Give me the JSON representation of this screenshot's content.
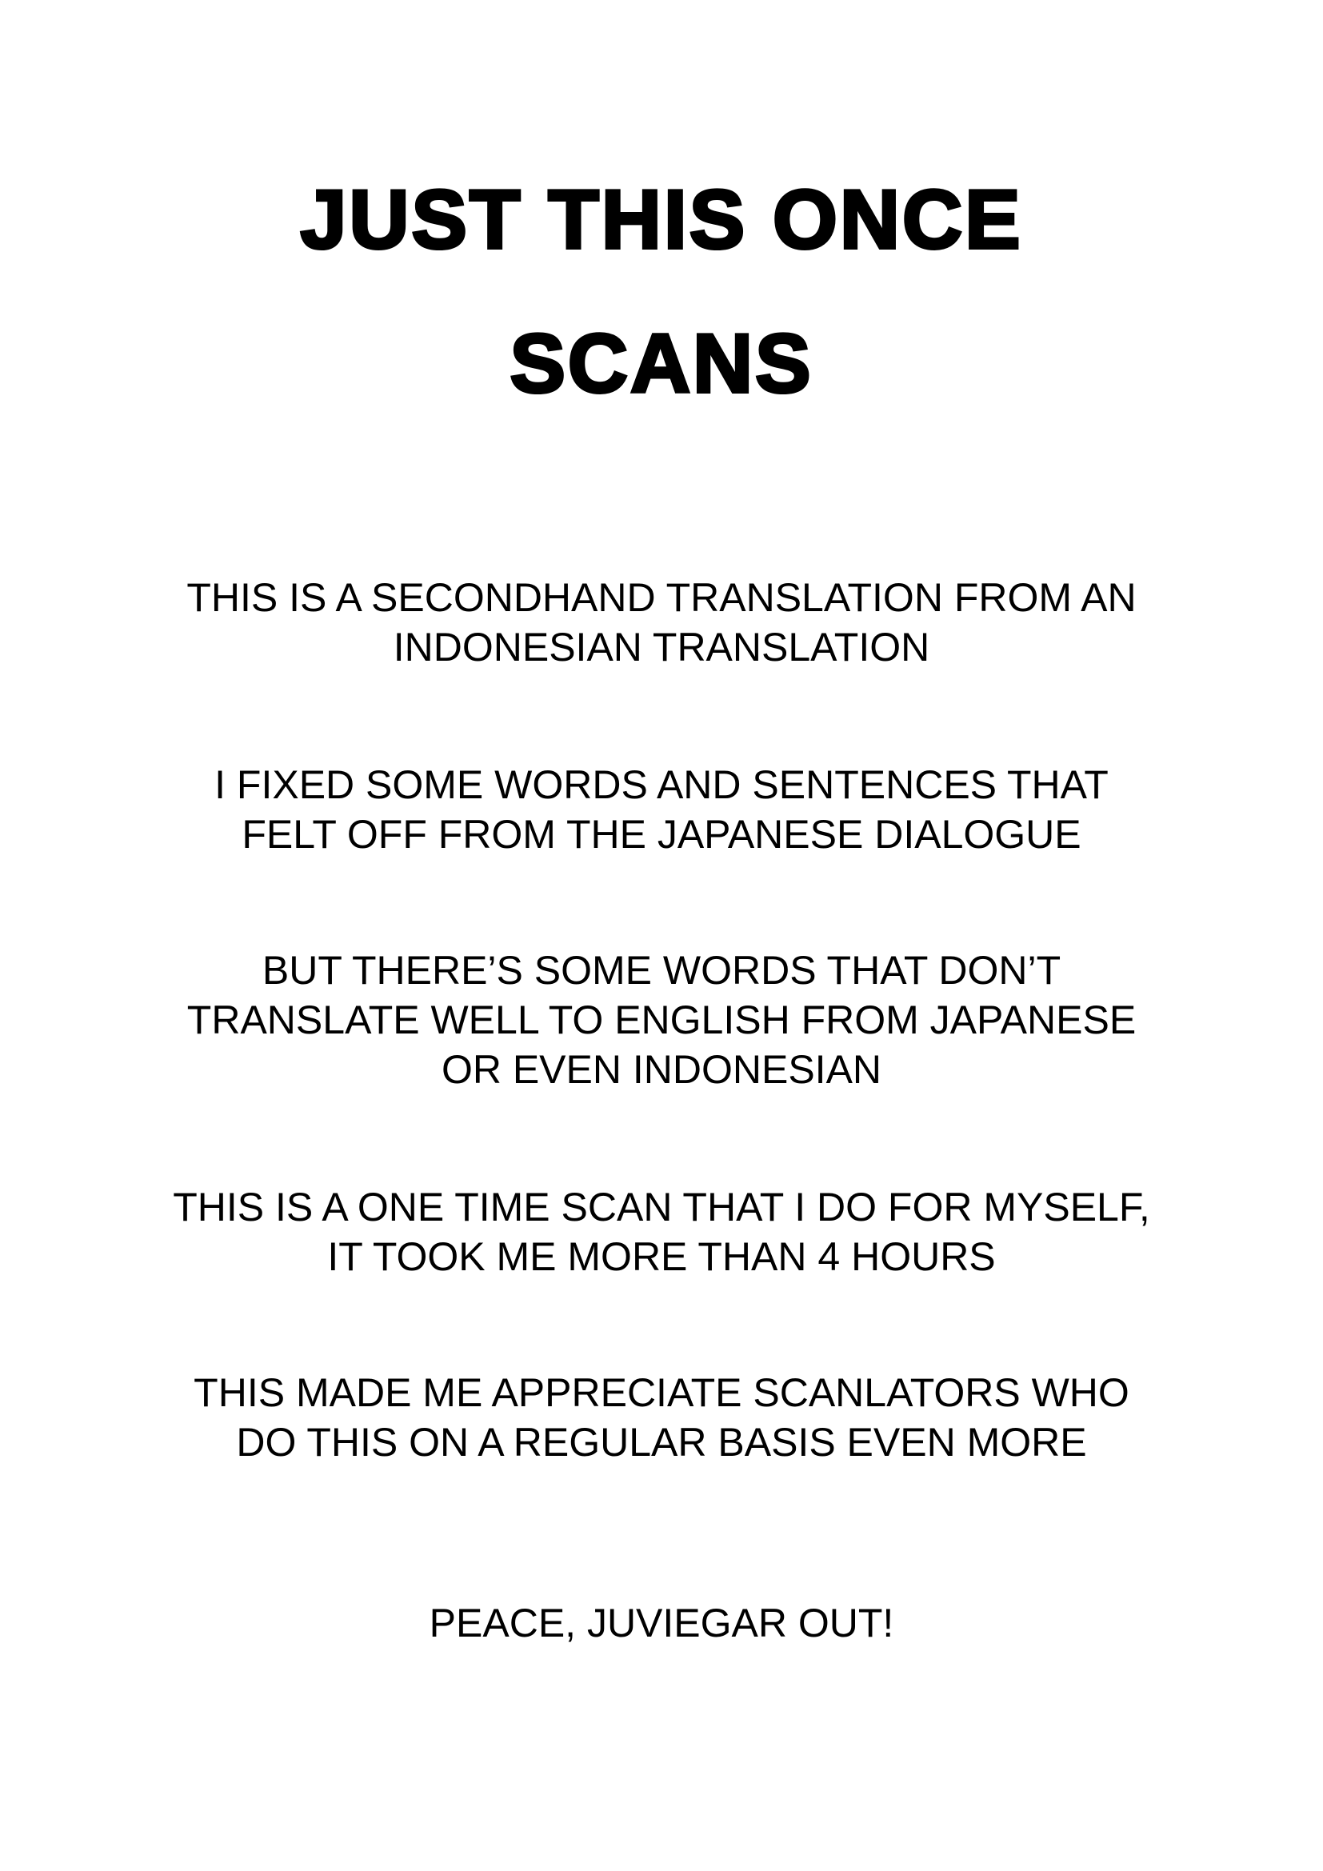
{
  "title": {
    "line1": "JUST THIS ONCE",
    "line2": "SCANS"
  },
  "paragraphs": [
    {
      "lines": [
        "THIS IS A SECONDHAND TRANSLATION FROM AN",
        "INDONESIAN TRANSLATION"
      ]
    },
    {
      "lines": [
        "I FIXED SOME WORDS AND SENTENCES THAT",
        "FELT OFF FROM THE JAPANESE DIALOGUE"
      ]
    },
    {
      "lines": [
        "BUT THERE’S SOME WORDS THAT DON’T",
        "TRANSLATE WELL TO ENGLISH FROM JAPANESE",
        "OR EVEN INDONESIAN"
      ]
    },
    {
      "lines": [
        "THIS IS A ONE TIME SCAN THAT I DO FOR MYSELF,",
        "IT TOOK ME MORE THAN 4 HOURS"
      ]
    },
    {
      "lines": [
        "THIS MADE ME APPRECIATE SCANLATORS WHO",
        "DO THIS ON A REGULAR BASIS EVEN MORE"
      ]
    },
    {
      "lines": [
        "PEACE, JUVIEGAR OUT!"
      ]
    }
  ]
}
